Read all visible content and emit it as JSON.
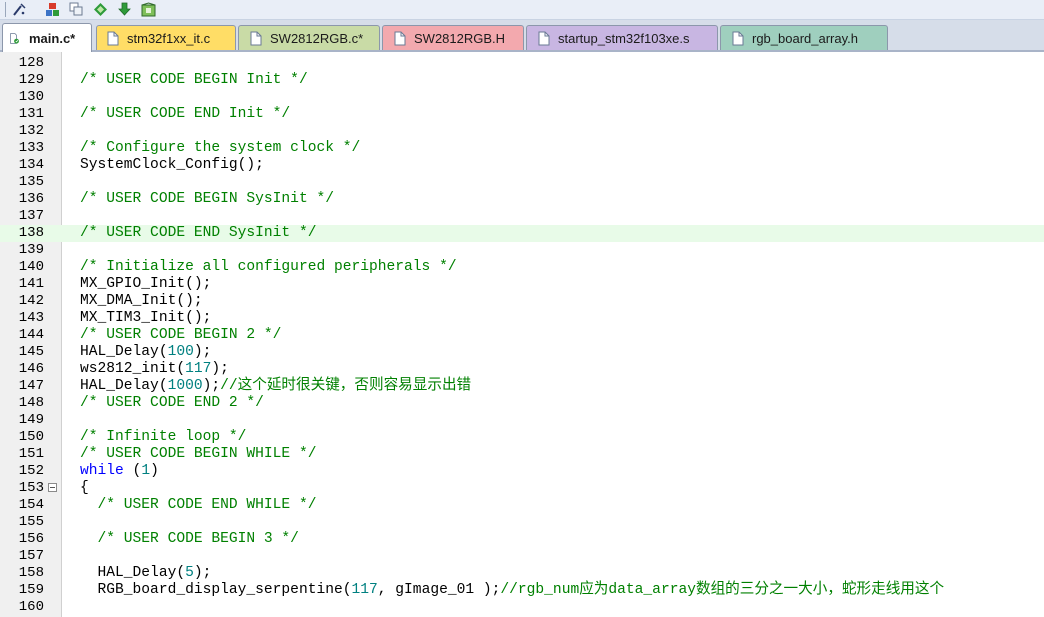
{
  "toolbar": {
    "buttons": [
      {
        "icon": "wizard-icon"
      },
      {
        "icon": "component-icon"
      },
      {
        "icon": "copy-icon"
      },
      {
        "icon": "diamond-icon"
      },
      {
        "icon": "download-icon"
      },
      {
        "icon": "package-icon"
      }
    ]
  },
  "tabs": [
    {
      "label": "main.c*",
      "color": "#ffffff",
      "active": true
    },
    {
      "label": "stm32f1xx_it.c",
      "color": "#ffdd66"
    },
    {
      "label": "SW2812RGB.c*",
      "color": "#c9dba6"
    },
    {
      "label": "SW2812RGB.H",
      "color": "#f3a9ae"
    },
    {
      "label": "startup_stm32f103xe.s",
      "color": "#c8b6e2"
    },
    {
      "label": "rgb_board_array.h",
      "color": "#9fcfbe"
    }
  ],
  "editor": {
    "highlighted_line": 138,
    "fold_line": 153,
    "lines": [
      {
        "n": "128",
        "parts": []
      },
      {
        "n": "129",
        "parts": [
          {
            "t": "/* USER CODE BEGIN Init */",
            "c": "cm"
          }
        ]
      },
      {
        "n": "130",
        "parts": []
      },
      {
        "n": "131",
        "parts": [
          {
            "t": "/* USER CODE END Init */",
            "c": "cm"
          }
        ]
      },
      {
        "n": "132",
        "parts": []
      },
      {
        "n": "133",
        "parts": [
          {
            "t": "/* Configure the system clock */",
            "c": "cm"
          }
        ]
      },
      {
        "n": "134",
        "parts": [
          {
            "t": "SystemClock_Config();",
            "c": "tx"
          }
        ]
      },
      {
        "n": "135",
        "parts": []
      },
      {
        "n": "136",
        "parts": [
          {
            "t": "/* USER CODE BEGIN SysInit */",
            "c": "cm"
          }
        ]
      },
      {
        "n": "137",
        "parts": []
      },
      {
        "n": "138",
        "parts": [
          {
            "t": "/* USER CODE END SysInit */",
            "c": "cm"
          }
        ]
      },
      {
        "n": "139",
        "parts": []
      },
      {
        "n": "140",
        "parts": [
          {
            "t": "/* Initialize all configured peripherals */",
            "c": "cm"
          }
        ]
      },
      {
        "n": "141",
        "parts": [
          {
            "t": "MX_GPIO_Init();",
            "c": "tx"
          }
        ]
      },
      {
        "n": "142",
        "parts": [
          {
            "t": "MX_DMA_Init();",
            "c": "tx"
          }
        ]
      },
      {
        "n": "143",
        "parts": [
          {
            "t": "MX_TIM3_Init();",
            "c": "tx"
          }
        ]
      },
      {
        "n": "144",
        "parts": [
          {
            "t": "/* USER CODE BEGIN 2 */",
            "c": "cm"
          }
        ]
      },
      {
        "n": "145",
        "parts": [
          {
            "t": "HAL_Delay(",
            "c": "tx"
          },
          {
            "t": "100",
            "c": "num"
          },
          {
            "t": ");",
            "c": "tx"
          }
        ]
      },
      {
        "n": "146",
        "parts": [
          {
            "t": "ws2812_init(",
            "c": "tx"
          },
          {
            "t": "117",
            "c": "num"
          },
          {
            "t": ");",
            "c": "tx"
          }
        ]
      },
      {
        "n": "147",
        "parts": [
          {
            "t": "HAL_Delay(",
            "c": "tx"
          },
          {
            "t": "1000",
            "c": "num"
          },
          {
            "t": ");",
            "c": "tx"
          },
          {
            "t": "//这个延时很关键，否则容易显示出错",
            "c": "cm"
          }
        ]
      },
      {
        "n": "148",
        "parts": [
          {
            "t": "/* USER CODE END 2 */",
            "c": "cm"
          }
        ]
      },
      {
        "n": "149",
        "parts": []
      },
      {
        "n": "150",
        "parts": [
          {
            "t": "/* Infinite loop */",
            "c": "cm"
          }
        ]
      },
      {
        "n": "151",
        "parts": [
          {
            "t": "/* USER CODE BEGIN WHILE */",
            "c": "cm"
          }
        ]
      },
      {
        "n": "152",
        "parts": [
          {
            "t": "while",
            "c": "kw"
          },
          {
            "t": " (",
            "c": "tx"
          },
          {
            "t": "1",
            "c": "num"
          },
          {
            "t": ")",
            "c": "tx"
          }
        ]
      },
      {
        "n": "153",
        "parts": [
          {
            "t": "{",
            "c": "tx"
          }
        ]
      },
      {
        "n": "154",
        "parts": [
          {
            "t": "  /* USER CODE END WHILE */",
            "c": "cm"
          }
        ]
      },
      {
        "n": "155",
        "parts": []
      },
      {
        "n": "156",
        "parts": [
          {
            "t": "  /* USER CODE BEGIN 3 */",
            "c": "cm"
          }
        ]
      },
      {
        "n": "157",
        "parts": []
      },
      {
        "n": "158",
        "parts": [
          {
            "t": "  HAL_Delay(",
            "c": "tx"
          },
          {
            "t": "5",
            "c": "num"
          },
          {
            "t": ");",
            "c": "tx"
          }
        ]
      },
      {
        "n": "159",
        "parts": [
          {
            "t": "  RGB_board_display_serpentine(",
            "c": "tx"
          },
          {
            "t": "117",
            "c": "num"
          },
          {
            "t": ", gImage_01 );",
            "c": "tx"
          },
          {
            "t": "//rgb_num应为data_array数组的三分之一大小，蛇形走线用这个",
            "c": "cm"
          }
        ]
      },
      {
        "n": "160",
        "parts": []
      }
    ]
  }
}
